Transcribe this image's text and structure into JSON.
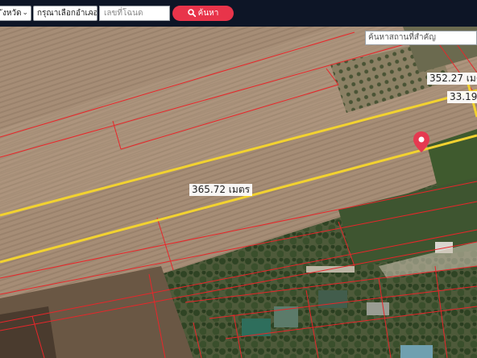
{
  "toolbar": {
    "province_select": "ังหวัด",
    "district_select": "กรุณาเลือกอำเภอ",
    "deed_placeholder": "เลขที่โฉนด",
    "search_button": "ค้นหา"
  },
  "map": {
    "place_search_placeholder": "ค้นหาสถานที่สำคัญ",
    "measurements": {
      "top_side": "352.27 เมต",
      "short_side": "33.19",
      "long_side": "365.72 เมตร"
    },
    "colors": {
      "plot_outline": "#f2d230",
      "parcel_lines": "#e8262a",
      "marker": "#e53950",
      "search_button": "#e8344a"
    }
  }
}
